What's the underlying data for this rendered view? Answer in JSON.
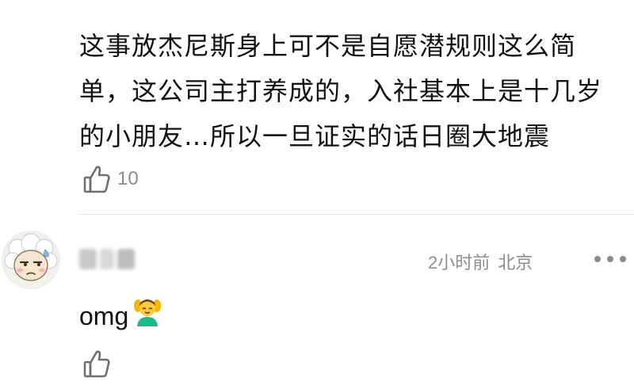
{
  "comment": {
    "text": "这事放杰尼斯身上可不是自愿潜规则这么简单，这公司主打养成的，入社基本上是十几岁的小朋友…所以一旦证实的话日圈大地震",
    "like_count": "10",
    "like_icon": "thumbs-up-icon"
  },
  "reply": {
    "avatar": "sheep-avatar",
    "username_blurred": true,
    "time": "2小时前",
    "location": "北京",
    "more_icon": "more-dots-icon",
    "text": "omg",
    "emoji": "person-getting-massage-emoji",
    "like_icon": "thumbs-up-icon"
  }
}
